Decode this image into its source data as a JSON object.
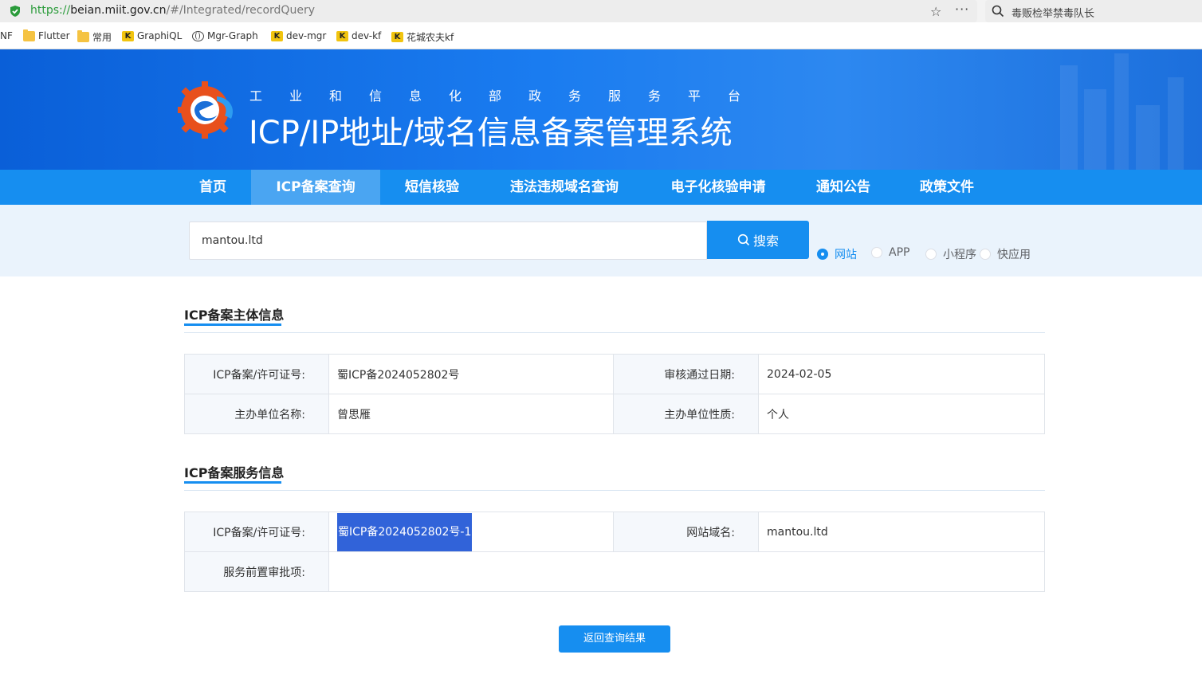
{
  "browser": {
    "url_scheme": "https://",
    "url_host": "beian.miit.gov.cn",
    "url_path": "/#/Integrated/recordQuery",
    "search_text": "毒贩检举禁毒队长",
    "bookmarks": [
      "NF",
      "Flutter",
      "常用",
      "GraphiQL",
      "Mgr-Graph",
      "dev-mgr",
      "dev-kf",
      "花城农夫kf"
    ]
  },
  "header": {
    "subtitle": "工业和信息化部政务服务平台",
    "title": "ICP/IP地址/域名信息备案管理系统"
  },
  "nav": {
    "items": [
      "首页",
      "ICP备案查询",
      "短信核验",
      "违法违规域名查询",
      "电子化核验申请",
      "通知公告",
      "政策文件"
    ]
  },
  "search": {
    "value": "mantou.ltd",
    "button": "搜索",
    "options": [
      "网站",
      "APP",
      "小程序",
      "快应用"
    ],
    "selected": "网站"
  },
  "subject_info": {
    "title": "ICP备案主体信息",
    "license_label": "ICP备案/许可证号:",
    "license_value": "蜀ICP备2024052802号",
    "date_label": "审核通过日期:",
    "date_value": "2024-02-05",
    "org_label": "主办单位名称:",
    "org_value": "曾思雁",
    "nature_label": "主办单位性质:",
    "nature_value": "个人"
  },
  "service_info": {
    "title": "ICP备案服务信息",
    "license_label": "ICP备案/许可证号:",
    "license_value": "蜀ICP备2024052802号-1",
    "domain_label": "网站域名:",
    "domain_value": "mantou.ltd",
    "approval_label": "服务前置审批项:",
    "approval_value": ""
  },
  "back_button": "返回查询结果",
  "colors": {
    "primary": "#168ef0",
    "nav_active": "#4aa5f2",
    "highlight": "#3163d9"
  }
}
